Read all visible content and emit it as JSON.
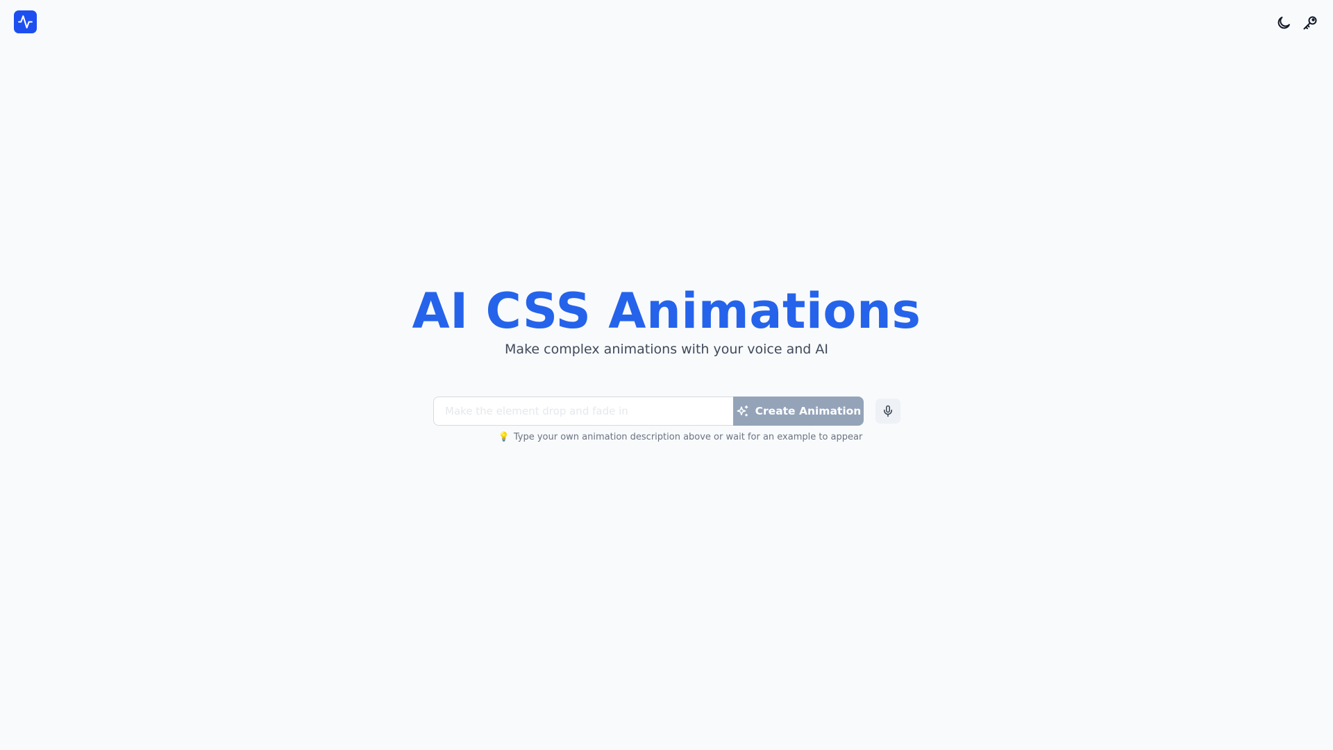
{
  "header": {
    "logo_icon": "activity-pulse-icon",
    "logo_color": "#1d4ff0",
    "theme_toggle_icon": "moon-icon",
    "api_key_icon": "key-icon"
  },
  "hero": {
    "title": "AI CSS Animations",
    "title_color": "#2563eb",
    "subtitle": "Make complex animations with your voice and AI"
  },
  "prompt": {
    "placeholder": "Make the element drop and fade in",
    "value": "",
    "create_button_label": "Create Animation",
    "create_button_icon": "sparkles-icon",
    "create_button_color": "#94a3b8",
    "mic_icon": "microphone-icon"
  },
  "hint": {
    "icon": "lightbulb-icon",
    "text": "Type your own animation description above or wait for an example to appear"
  }
}
